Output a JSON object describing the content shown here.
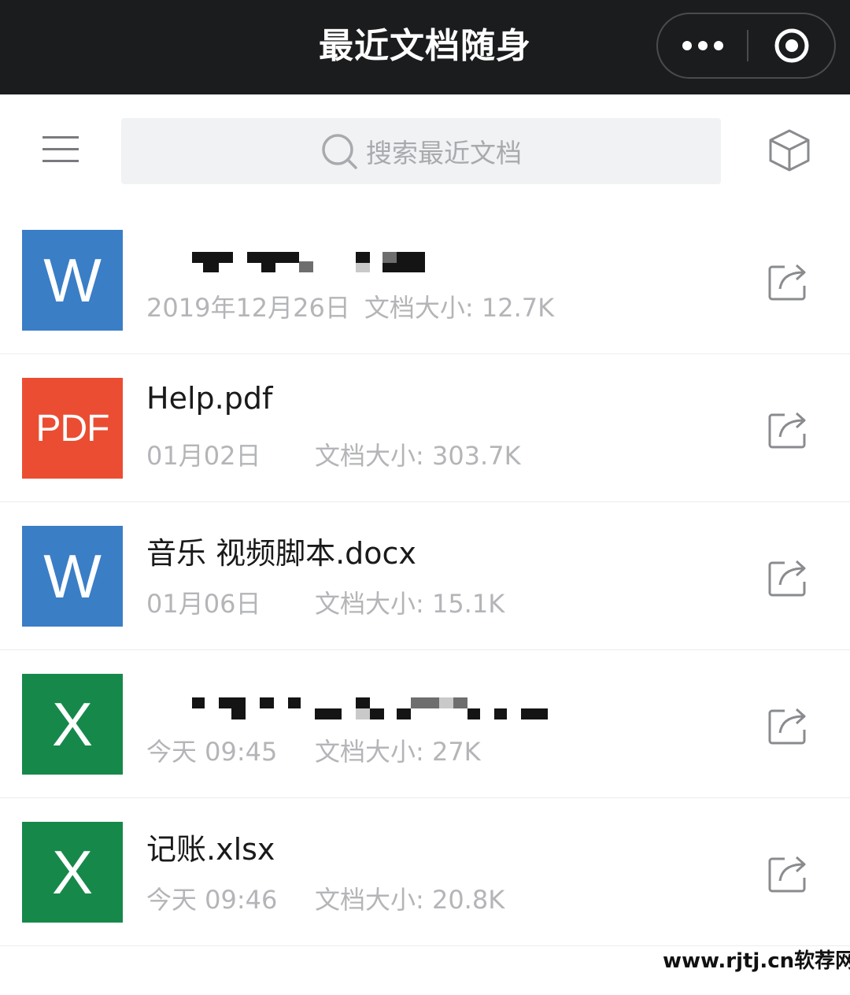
{
  "header": {
    "title": "最近文档随身",
    "more_icon": "more-dots-icon",
    "close_icon": "target-circle-icon"
  },
  "toolbar": {
    "menu_icon": "hamburger-menu-icon",
    "search_placeholder": "搜索最近文档",
    "cube_icon": "cube-icon"
  },
  "files": [
    {
      "type": "word",
      "icon_label": "W",
      "name": "",
      "name_redacted": true,
      "date": "2019年12月26日",
      "size": "文档大小: 12.7K"
    },
    {
      "type": "pdf",
      "icon_label": "PDF",
      "name": "Help.pdf",
      "date": "01月02日",
      "size": "文档大小: 303.7K"
    },
    {
      "type": "word",
      "icon_label": "W",
      "name": "音乐 视频脚本.docx",
      "date": "01月06日",
      "size": "文档大小: 15.1K"
    },
    {
      "type": "excel",
      "icon_label": "X",
      "name": "",
      "name_redacted": true,
      "date": "今天 09:45",
      "size": "文档大小: 27K"
    },
    {
      "type": "excel",
      "icon_label": "X",
      "name": "记账.xlsx",
      "date": "今天 09:46",
      "size": "文档大小: 20.8K"
    }
  ],
  "colors": {
    "header_bg": "#1b1c1e",
    "word": "#3a7ec6",
    "pdf": "#eb4d33",
    "excel": "#16894a",
    "meta_text": "#b4b5b8"
  },
  "watermark": "www.rjtj.cn软荐网"
}
